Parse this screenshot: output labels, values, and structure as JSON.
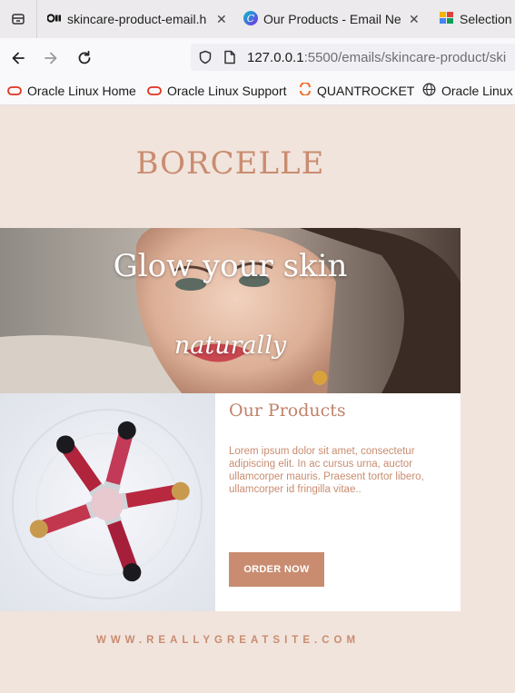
{
  "browser": {
    "tabs": [
      {
        "title": "skincare-product-email.h",
        "favicon": "codepen-icon",
        "active": true
      },
      {
        "title": "Our Products - Email Ne",
        "favicon": "canva-icon",
        "active": false
      },
      {
        "title": "Selection",
        "favicon": "colorful-grid-icon",
        "active": false
      }
    ],
    "url": {
      "host": "127.0.0.1",
      "path": ":5500/emails/skincare-product/ski"
    },
    "bookmarks": [
      {
        "label": "Oracle Linux Home",
        "icon": "oracle-icon"
      },
      {
        "label": "Oracle Linux Support",
        "icon": "oracle-icon"
      },
      {
        "label": "QUANTROCKET",
        "icon": "quantrocket-icon"
      },
      {
        "label": "Oracle Linux",
        "icon": "globe-icon"
      }
    ]
  },
  "email": {
    "brand": "BORCELLE",
    "hero": {
      "title": "Glow your skin",
      "subtitle": "naturally"
    },
    "products": {
      "heading": "Our Products",
      "body": "Lorem ipsum dolor sit amet, consectetur adipiscing elit. In ac cursus urna, auctor ullamcorper mauris. Praesent tortor libero, ullamcorper id fringilla vitae..",
      "cta": "ORDER NOW"
    },
    "footer": {
      "site": "WWW.REALLYGREATSITE.COM"
    }
  },
  "colors": {
    "accent": "#c98c70",
    "background": "#f1e4dc",
    "panel": "#ffffff"
  }
}
